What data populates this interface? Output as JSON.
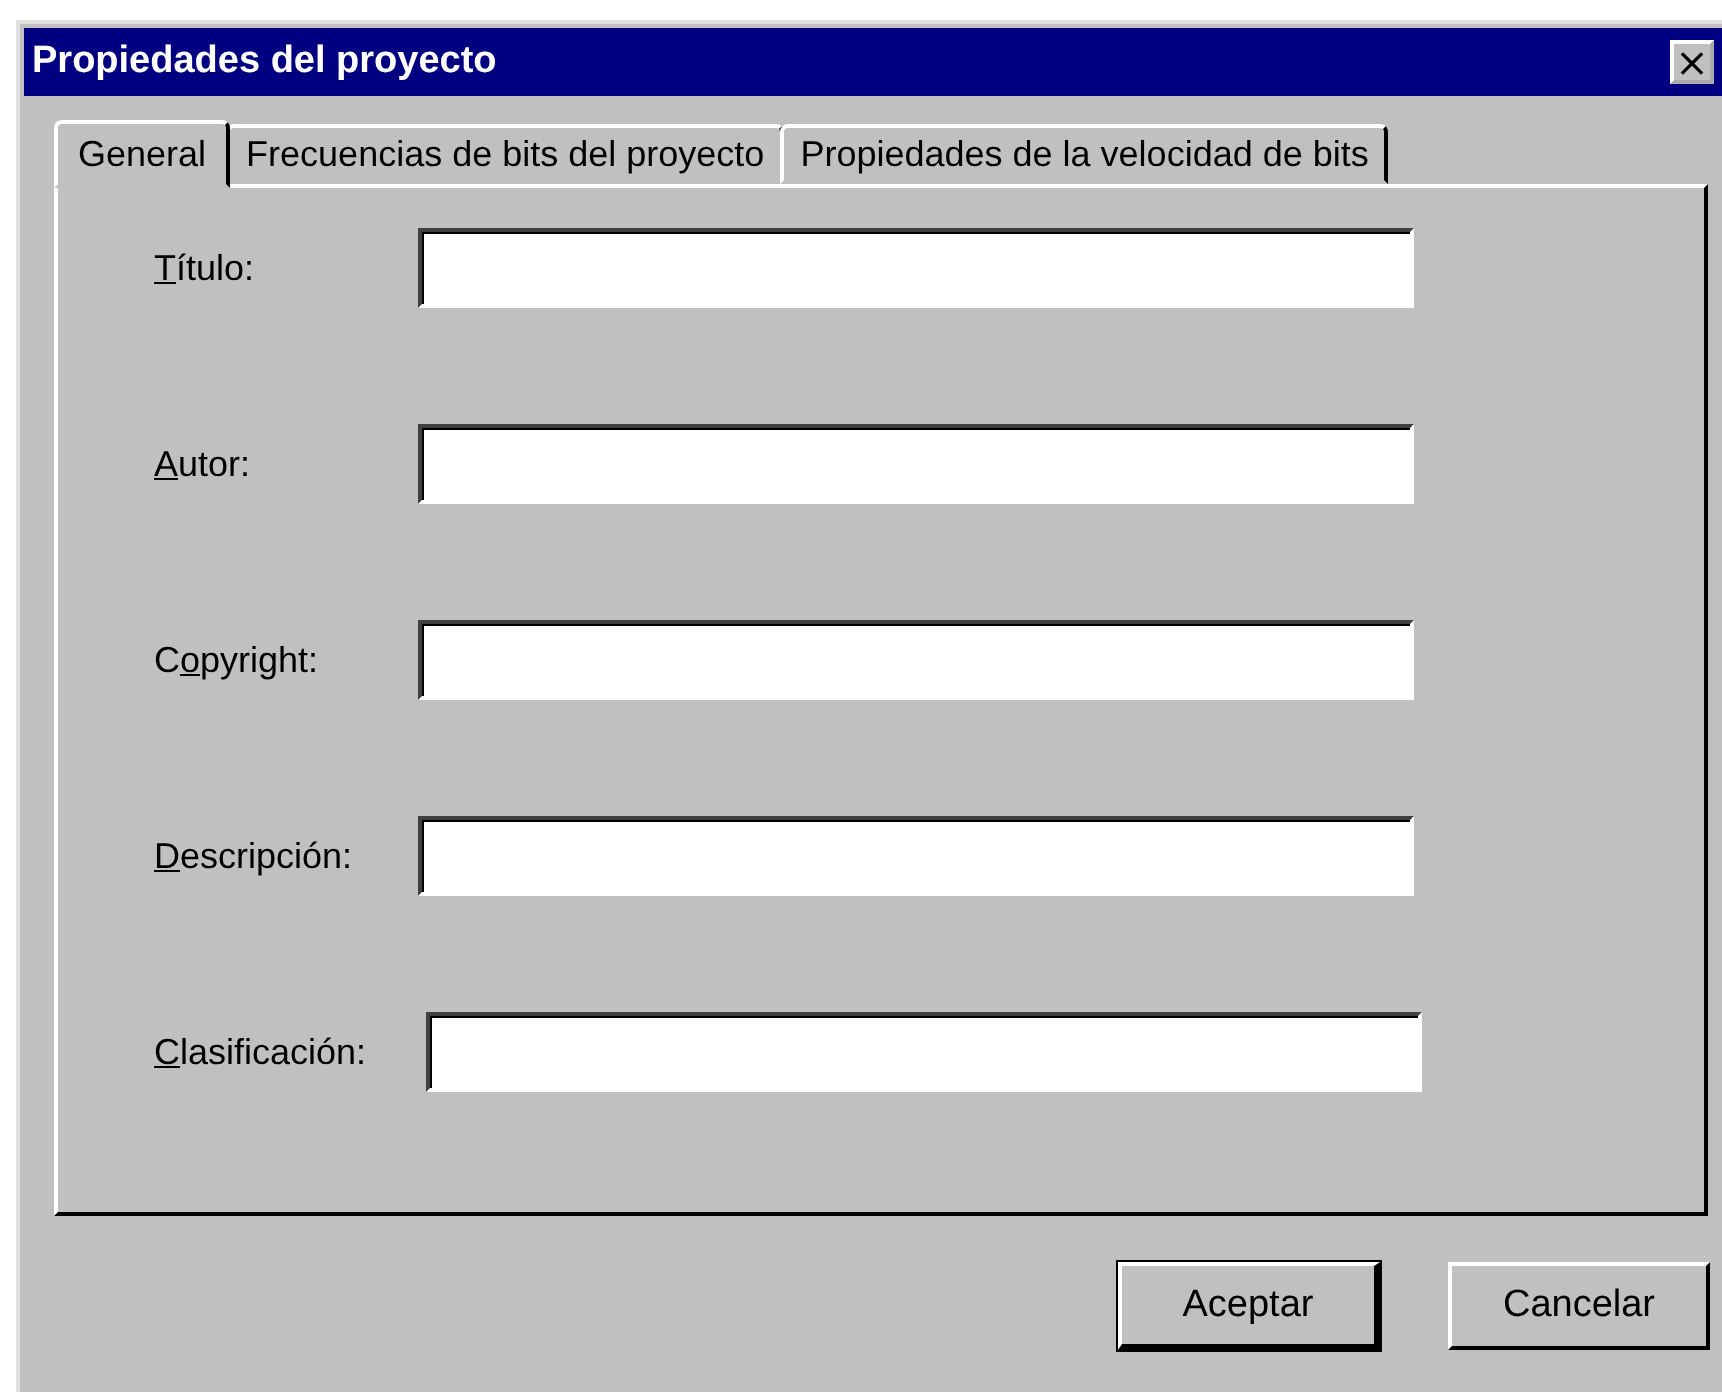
{
  "window": {
    "title": "Propiedades del proyecto",
    "close": "×"
  },
  "tabs": [
    {
      "label": "General",
      "selected": true
    },
    {
      "label": "Frecuencias de bits del proyecto",
      "selected": false
    },
    {
      "label": "Propiedades de la velocidad de bits",
      "selected": false
    }
  ],
  "fields": [
    {
      "label": {
        "key": "T",
        "after": "ítulo:"
      }
    },
    {
      "label": {
        "key": "A",
        "after": "utor:"
      }
    },
    {
      "label": {
        "before": "C",
        "key": "o",
        "after": "pyright:"
      }
    },
    {
      "label": {
        "key": "D",
        "after": "escripción:"
      }
    },
    {
      "label": {
        "key": "C",
        "after": "lasificación:"
      }
    }
  ],
  "buttons": [
    {
      "label": "Aceptar",
      "default": true
    },
    {
      "label": "Cancelar",
      "default": false
    }
  ]
}
